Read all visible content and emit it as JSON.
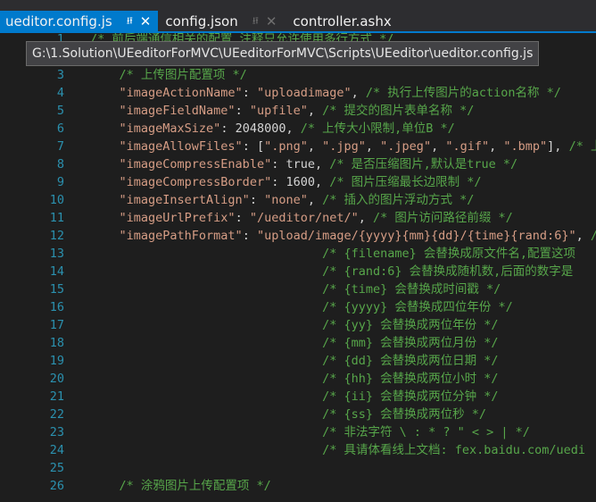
{
  "tabs": [
    {
      "label": "ueditor.config.js",
      "active": true
    },
    {
      "label": "config.json",
      "active": false
    },
    {
      "label": "controller.ashx",
      "active": false
    }
  ],
  "tooltip": "G:\\1.Solution\\UEeditorForMVC\\UEeditorForMVC\\Scripts\\UEeditor\\ueditor.config.js",
  "editor": {
    "lines": [
      {
        "n": "1",
        "text": "/* 前后端通信相关的配置,注释只允许使用多行方式 */"
      },
      {
        "n": "2",
        "text": ""
      },
      {
        "n": "3",
        "text": "    /* 上传图片配置项 */"
      },
      {
        "n": "4",
        "text": "    \"imageActionName\": \"uploadimage\", /* 执行上传图片的action名称 */"
      },
      {
        "n": "5",
        "text": "    \"imageFieldName\": \"upfile\", /* 提交的图片表单名称 */"
      },
      {
        "n": "6",
        "text": "    \"imageMaxSize\": 2048000, /* 上传大小限制,单位B */"
      },
      {
        "n": "7",
        "text": "    \"imageAllowFiles\": [\".png\", \".jpg\", \".jpeg\", \".gif\", \".bmp\"], /* 上"
      },
      {
        "n": "8",
        "text": "    \"imageCompressEnable\": true, /* 是否压缩图片,默认是true */"
      },
      {
        "n": "9",
        "text": "    \"imageCompressBorder\": 1600, /* 图片压缩最长边限制 */"
      },
      {
        "n": "10",
        "text": "    \"imageInsertAlign\": \"none\", /* 插入的图片浮动方式 */"
      },
      {
        "n": "11",
        "text": "    \"imageUrlPrefix\": \"/ueditor/net/\", /* 图片访问路径前缀 */"
      },
      {
        "n": "12",
        "text": "    \"imagePathFormat\": \"upload/image/{yyyy}{mm}{dd}/{time}{rand:6}\", /*"
      },
      {
        "n": "13",
        "text": "                                /* {filename} 会替换成原文件名,配置这项"
      },
      {
        "n": "14",
        "text": "                                /* {rand:6} 会替换成随机数,后面的数字是"
      },
      {
        "n": "15",
        "text": "                                /* {time} 会替换成时间戳 */"
      },
      {
        "n": "16",
        "text": "                                /* {yyyy} 会替换成四位年份 */"
      },
      {
        "n": "17",
        "text": "                                /* {yy} 会替换成两位年份 */"
      },
      {
        "n": "18",
        "text": "                                /* {mm} 会替换成两位月份 */"
      },
      {
        "n": "19",
        "text": "                                /* {dd} 会替换成两位日期 */"
      },
      {
        "n": "20",
        "text": "                                /* {hh} 会替换成两位小时 */"
      },
      {
        "n": "21",
        "text": "                                /* {ii} 会替换成两位分钟 */"
      },
      {
        "n": "22",
        "text": "                                /* {ss} 会替换成两位秒 */"
      },
      {
        "n": "23",
        "text": "                                /* 非法字符 \\ : * ? \" < > | */"
      },
      {
        "n": "24",
        "text": "                                /* 具请体看线上文档: fex.baidu.com/uedi"
      },
      {
        "n": "25",
        "text": ""
      },
      {
        "n": "26",
        "text": "    /* 涂鸦图片上传配置项 */"
      }
    ]
  }
}
